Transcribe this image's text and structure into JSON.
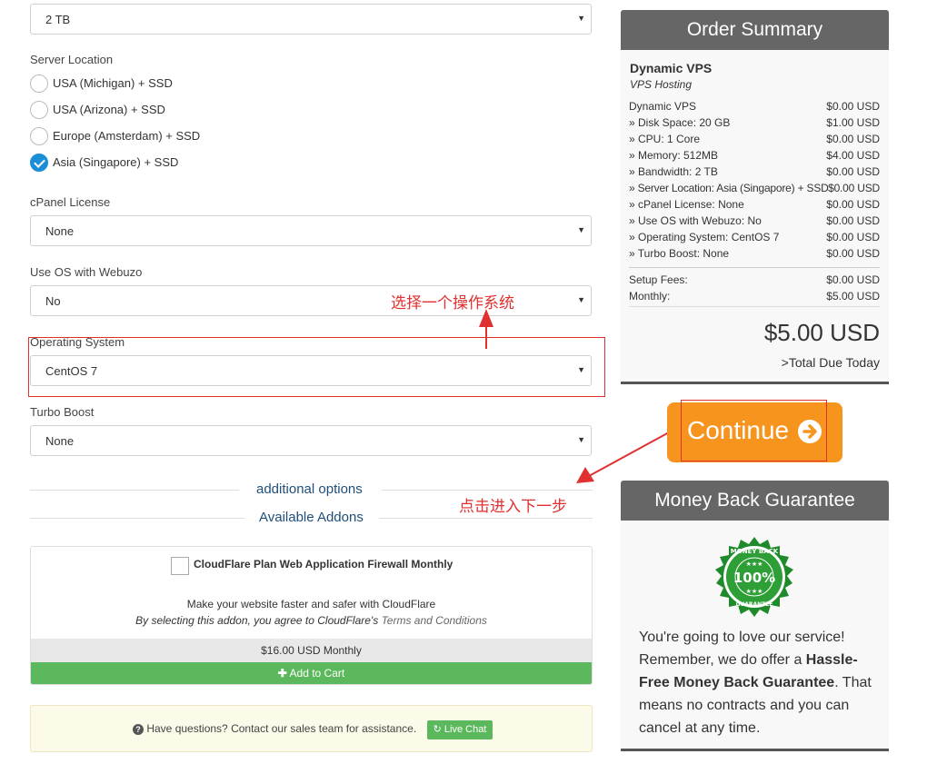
{
  "bandwidth": {
    "value": "2 TB"
  },
  "server_location": {
    "label": "Server Location",
    "options": [
      {
        "label": "USA (Michigan) + SSD",
        "checked": false
      },
      {
        "label": "USA (Arizona) + SSD",
        "checked": false
      },
      {
        "label": "Europe (Amsterdam) + SSD",
        "checked": false
      },
      {
        "label": "Asia (Singapore) + SSD",
        "checked": true
      }
    ]
  },
  "cpanel": {
    "label": "cPanel License",
    "value": "None"
  },
  "webuzo": {
    "label": "Use OS with Webuzo",
    "value": "No"
  },
  "os": {
    "label": "Operating System",
    "value": "CentOS 7"
  },
  "turbo": {
    "label": "Turbo Boost",
    "value": "None"
  },
  "annotations": {
    "select_os": "选择一个操作系统",
    "next_step": "点击进入下一步",
    "color": "#e03030"
  },
  "dividers": {
    "additional": "additional options",
    "addons": "Available Addons"
  },
  "addon": {
    "title": "CloudFlare Plan Web Application Firewall Monthly",
    "desc": "Make your website faster and safer with CloudFlare",
    "agree_prefix": "By selecting this addon, you agree to CloudFlare's",
    "agree_link": "Terms and Conditions",
    "price": "$16.00 USD Monthly",
    "add_to_cart": "Add to Cart",
    "cart_color": "#5cb85c"
  },
  "help": {
    "text": "Have questions? Contact our sales team for assistance.",
    "live_chat": "Live Chat"
  },
  "order_summary": {
    "title": "Order Summary",
    "product_name": "Dynamic VPS",
    "product_group": "VPS Hosting",
    "lines": [
      {
        "label": "Dynamic VPS",
        "price": "$0.00 USD"
      },
      {
        "label": "» Disk Space: 20 GB",
        "price": "$1.00 USD"
      },
      {
        "label": "» CPU: 1 Core",
        "price": "$0.00 USD"
      },
      {
        "label": "» Memory: 512MB",
        "price": "$4.00 USD"
      },
      {
        "label": "» Bandwidth: 2 TB",
        "price": "$0.00 USD"
      },
      {
        "label": "» Server Location: Asia (Singapore) + SSD",
        "price": "$0.00 USD"
      },
      {
        "label": "» cPanel License: None",
        "price": "$0.00 USD"
      },
      {
        "label": "» Use OS with Webuzo: No",
        "price": "$0.00 USD"
      },
      {
        "label": "» Operating System: CentOS 7",
        "price": "$0.00 USD"
      },
      {
        "label": "» Turbo Boost: None",
        "price": "$0.00 USD"
      }
    ],
    "setup_fees_label": "Setup Fees:",
    "setup_fees": "$0.00 USD",
    "monthly_label": "Monthly:",
    "monthly": "$5.00 USD",
    "total": "$5.00 USD",
    "total_label": ">Total Due Today"
  },
  "continue": {
    "label": "Continue",
    "color": "#f7941d"
  },
  "guarantee": {
    "title": "Money Back Guarantee",
    "seal_top": "MONEY BACK",
    "seal_center": "100%",
    "seal_bottom": "GUARANTEE",
    "text_1": "You're going to love our service! Remember, we do offer a ",
    "text_bold": "Hassle-Free Money Back Guarantee",
    "text_2": ". That means no contracts and you can cancel at any time."
  }
}
